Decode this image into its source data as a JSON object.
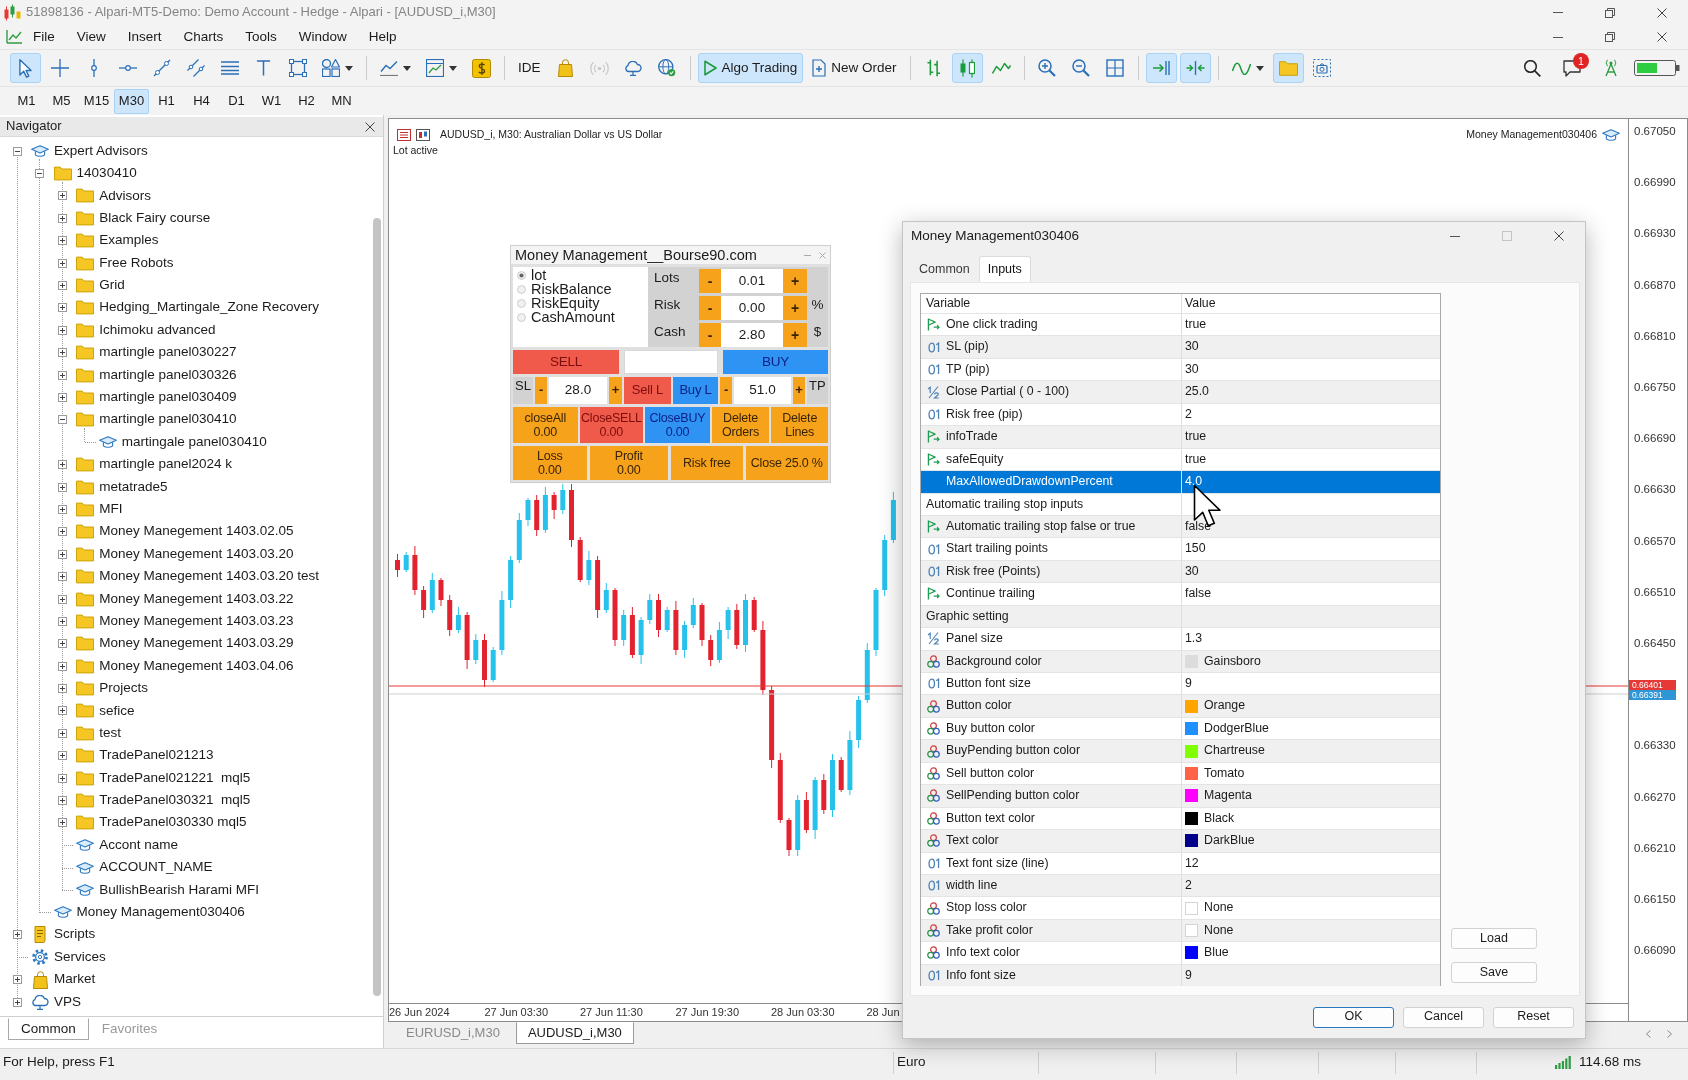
{
  "window": {
    "title": "51898136 - Alpari-MT5-Demo: Demo Account - Hedge - Alpari - [AUDUSD_i,M30]"
  },
  "menu": [
    "File",
    "View",
    "Insert",
    "Charts",
    "Tools",
    "Window",
    "Help"
  ],
  "toolbar": {
    "groups": [
      {
        "items": [
          {
            "selected": true
          },
          {
            "selected": false
          },
          {
            "selected": false
          },
          {
            "selected": false
          },
          {
            "selected": false
          },
          {
            "selected": false
          },
          {
            "selected": false
          },
          {
            "selected": false
          },
          {
            "selected": false
          },
          {
            "selected": false,
            "dropdown": true
          }
        ]
      },
      {
        "items": [
          {
            "selected": false,
            "dropdown": true
          },
          {
            "selected": false,
            "dropdown": true
          },
          {
            "selected": false
          }
        ]
      },
      {
        "items": [
          {
            "label": "IDE",
            "selected": false,
            "disabled": false
          },
          {
            "selected": false,
            "disabled": false
          },
          {
            "selected": false,
            "disabled": true
          },
          {
            "selected": false,
            "disabled": false
          },
          {
            "selected": false,
            "disabled": false
          }
        ]
      },
      {
        "items": [
          {
            "label": "Algo Trading",
            "selected": true
          },
          {
            "label": "New Order",
            "selected": false
          }
        ]
      },
      {
        "items": [
          {
            "selected": false
          },
          {
            "selected": true
          },
          {
            "selected": false
          }
        ]
      },
      {
        "items": [
          {
            "selected": false
          },
          {
            "selected": false
          },
          {
            "selected": false
          }
        ]
      },
      {
        "items": [
          {
            "selected": true
          },
          {
            "selected": true
          }
        ]
      },
      {
        "items": [
          {
            "selected": false,
            "dropdown": true
          },
          {
            "selected": true
          },
          {
            "selected": false
          }
        ]
      }
    ],
    "notification_badge": "1"
  },
  "timeframes": [
    {
      "label": "M1",
      "selected": false
    },
    {
      "label": "M5",
      "selected": false
    },
    {
      "label": "M15",
      "selected": false
    },
    {
      "label": "M30",
      "selected": true
    },
    {
      "label": "H1",
      "selected": false
    },
    {
      "label": "H4",
      "selected": false
    },
    {
      "label": "D1",
      "selected": false
    },
    {
      "label": "W1",
      "selected": false
    },
    {
      "label": "H2",
      "selected": false
    },
    {
      "label": "MN",
      "selected": false
    }
  ],
  "navigator": {
    "title": "Navigator",
    "items": [
      {
        "kind": "program",
        "label": "Expert Advisors",
        "expanded": true,
        "children": [
          {
            "kind": "folder",
            "label": "14030410",
            "expanded": true,
            "children": [
              {
                "kind": "folder",
                "label": "Advisors",
                "expanded": false
              },
              {
                "kind": "folder",
                "label": "Black Fairy course",
                "expanded": false
              },
              {
                "kind": "folder",
                "label": "Examples",
                "expanded": false
              },
              {
                "kind": "folder",
                "label": "Free Robots",
                "expanded": false
              },
              {
                "kind": "folder",
                "label": "Grid",
                "expanded": false
              },
              {
                "kind": "folder",
                "label": "Hedging_Martingale_Zone Recovery",
                "expanded": false
              },
              {
                "kind": "folder",
                "label": "Ichimoku advanced",
                "expanded": false
              },
              {
                "kind": "folder",
                "label": "martingle panel030227",
                "expanded": false
              },
              {
                "kind": "folder",
                "label": "martingle panel030326",
                "expanded": false
              },
              {
                "kind": "folder",
                "label": "martingle panel030409",
                "expanded": false
              },
              {
                "kind": "folder",
                "label": "martingle panel030410",
                "expanded": true,
                "children": [
                  {
                    "kind": "program",
                    "label": "martingale panel030410"
                  }
                ]
              },
              {
                "kind": "folder",
                "label": "martingle panel2024 k",
                "expanded": false
              },
              {
                "kind": "folder",
                "label": "metatrade5",
                "expanded": false
              },
              {
                "kind": "folder",
                "label": "MFI",
                "expanded": false
              },
              {
                "kind": "folder",
                "label": "Money Manegement 1403.02.05",
                "expanded": false
              },
              {
                "kind": "folder",
                "label": "Money Manegement 1403.03.20",
                "expanded": false
              },
              {
                "kind": "folder",
                "label": "Money Manegement 1403.03.20 test",
                "expanded": false
              },
              {
                "kind": "folder",
                "label": "Money Manegement 1403.03.22",
                "expanded": false
              },
              {
                "kind": "folder",
                "label": "Money Manegement 1403.03.23",
                "expanded": false
              },
              {
                "kind": "folder",
                "label": "Money Manegement 1403.03.29",
                "expanded": false
              },
              {
                "kind": "folder",
                "label": "Money Manegement 1403.04.06",
                "expanded": false
              },
              {
                "kind": "folder",
                "label": "Projects",
                "expanded": false
              },
              {
                "kind": "folder",
                "label": "sefice",
                "expanded": false
              },
              {
                "kind": "folder",
                "label": "test",
                "expanded": false
              },
              {
                "kind": "folder",
                "label": "TradePanel021213",
                "expanded": false
              },
              {
                "kind": "folder",
                "label": "TradePanel021221  mql5",
                "expanded": false
              },
              {
                "kind": "folder",
                "label": "TradePanel030321  mql5",
                "expanded": false
              },
              {
                "kind": "folder",
                "label": "TradePanel030330 mql5",
                "expanded": false
              },
              {
                "kind": "program",
                "label": "Accont name"
              },
              {
                "kind": "program",
                "label": "ACCOUNT_NAME"
              },
              {
                "kind": "program",
                "label": "BullishBearish Harami MFI"
              }
            ]
          },
          {
            "kind": "program",
            "label": "Money Management030406"
          }
        ]
      },
      {
        "kind": "scripts",
        "label": "Scripts",
        "expanded": false
      },
      {
        "kind": "services",
        "label": "Services"
      },
      {
        "kind": "market",
        "label": "Market",
        "expanded": false
      },
      {
        "kind": "vps",
        "label": "VPS",
        "expanded": false
      }
    ],
    "tabs": [
      {
        "label": "Common",
        "selected": true
      },
      {
        "label": "Favorites",
        "selected": false
      }
    ]
  },
  "chart": {
    "caption": "AUDUSD_i, M30: Australian Dollar vs US Dollar",
    "status_text": "Lot active",
    "expert": "Money Management030406",
    "price_axis": [
      {
        "kind": "label",
        "text": "0.67050"
      },
      {
        "kind": "label",
        "text": "0.66990"
      },
      {
        "kind": "label",
        "text": "0.66930"
      },
      {
        "kind": "label",
        "text": "0.66870"
      },
      {
        "kind": "label",
        "text": "0.66810"
      },
      {
        "kind": "label",
        "text": "0.66750"
      },
      {
        "kind": "label",
        "text": "0.66690"
      },
      {
        "kind": "label",
        "text": "0.66630"
      },
      {
        "kind": "label",
        "text": "0.66570"
      },
      {
        "kind": "label",
        "text": "0.66510"
      },
      {
        "kind": "label",
        "text": "0.66450"
      },
      {
        "kind": "bid",
        "text": "0.66401"
      },
      {
        "kind": "ask",
        "text": "0.66391"
      },
      {
        "kind": "label",
        "text": "0.66330"
      },
      {
        "kind": "label",
        "text": "0.66270"
      },
      {
        "kind": "label",
        "text": "0.66210"
      },
      {
        "kind": "label",
        "text": "0.66150"
      },
      {
        "kind": "label",
        "text": "0.66090"
      }
    ],
    "time_labels": [
      "26 Jun 2024",
      "27 Jun 03:30",
      "27 Jun 11:30",
      "27 Jun 19:30",
      "28 Jun 03:30",
      "28 Jun"
    ],
    "tabs": [
      {
        "label": "EURUSD_i,M30",
        "selected": false
      },
      {
        "label": "AUDUSD_i,M30",
        "selected": true
      }
    ]
  },
  "trade_panel": {
    "title": "Money Management__Bourse90.com",
    "modes": [
      {
        "label": "lot",
        "selected": true
      },
      {
        "label": "RiskBalance",
        "selected": false
      },
      {
        "label": "RiskEquity",
        "selected": false
      },
      {
        "label": "CashAmount",
        "selected": false
      }
    ],
    "amounts": [
      {
        "label": "Lots",
        "minus": "-",
        "value": "0.01",
        "plus": "+"
      },
      {
        "label": "Risk",
        "minus": "-",
        "value": "0.00",
        "plus": "+",
        "unit": "%"
      },
      {
        "label": "Cash",
        "minus": "-",
        "value": "2.80",
        "plus": "+",
        "unit": "$"
      }
    ],
    "order_row": [
      {
        "kind": "sell",
        "label": "SELL"
      },
      {
        "kind": "field"
      },
      {
        "kind": "buy",
        "label": "BUY"
      }
    ],
    "stop_row": [
      {
        "kind": "caption",
        "label": "SL"
      },
      {
        "kind": "minus",
        "label": "-"
      },
      {
        "kind": "field",
        "value": "28.0"
      },
      {
        "kind": "plus",
        "label": "+"
      },
      {
        "kind": "sell",
        "label": "Sell L"
      },
      {
        "kind": "buy",
        "label": "Buy L"
      },
      {
        "kind": "minus",
        "label": "-"
      },
      {
        "kind": "field",
        "value": "51.0"
      },
      {
        "kind": "plus",
        "label": "+"
      },
      {
        "kind": "caption",
        "label": "TP"
      }
    ],
    "actions": [
      [
        {
          "kind": "neutral",
          "lines": [
            "closeAll",
            "0.00"
          ]
        },
        {
          "kind": "sell",
          "lines": [
            "CloseSELL",
            "0.00"
          ]
        },
        {
          "kind": "buy",
          "lines": [
            "CloseBUY",
            "0.00"
          ]
        },
        {
          "kind": "neutral",
          "lines": [
            "Delete",
            "Orders"
          ]
        },
        {
          "kind": "neutral",
          "lines": [
            "Delete",
            "Lines"
          ]
        }
      ],
      [
        {
          "kind": "neutral",
          "lines": [
            "Loss",
            "0.00"
          ]
        },
        {
          "kind": "neutral",
          "lines": [
            "Profit",
            "0.00"
          ]
        },
        {
          "kind": "neutral",
          "lines": [
            "Risk free"
          ]
        },
        {
          "kind": "neutral",
          "lines": [
            "Close 25.0 %"
          ]
        }
      ]
    ]
  },
  "dialog": {
    "title": "Money Management030406",
    "tabs": [
      {
        "label": "Common",
        "selected": false
      },
      {
        "label": "Inputs",
        "selected": true
      }
    ],
    "columns": [
      "Variable",
      "Value"
    ],
    "rows": [
      {
        "kind": "bool",
        "variable": "One click trading",
        "value": "true",
        "selected": false
      },
      {
        "kind": "int",
        "variable": "SL (pip)",
        "value": "30",
        "selected": false
      },
      {
        "kind": "int",
        "variable": "TP (pip)",
        "value": "30",
        "selected": false
      },
      {
        "kind": "double",
        "variable": "Close Partial ( 0 - 100)",
        "value": "25.0",
        "selected": false
      },
      {
        "kind": "int",
        "variable": "Risk free (pip)",
        "value": "2",
        "selected": false
      },
      {
        "kind": "bool",
        "variable": "infoTrade",
        "value": "true",
        "selected": false
      },
      {
        "kind": "bool",
        "variable": "safeEquity",
        "value": "true",
        "selected": false
      },
      {
        "kind": "plain",
        "variable": "MaxAllowedDrawdownPercent",
        "value": "4.0",
        "selected": true
      },
      {
        "kind": "group",
        "variable": "Automatic trailing stop inputs",
        "selected": false
      },
      {
        "kind": "bool",
        "variable": "Automatic trailing stop false or true",
        "value": "false",
        "selected": false
      },
      {
        "kind": "int",
        "variable": "Start trailing points",
        "value": "150",
        "selected": false
      },
      {
        "kind": "int",
        "variable": "Risk free (Points)",
        "value": "30",
        "selected": false
      },
      {
        "kind": "bool",
        "variable": "Continue trailing",
        "value": "false",
        "selected": false
      },
      {
        "kind": "group",
        "variable": "Graphic setting",
        "selected": false
      },
      {
        "kind": "double",
        "variable": "Panel size",
        "value": "1.3",
        "selected": false
      },
      {
        "kind": "color",
        "variable": "Background color",
        "value": "Gainsboro",
        "color": "#dcdcdc",
        "selected": false
      },
      {
        "kind": "int",
        "variable": "Button font size",
        "value": "9",
        "selected": false
      },
      {
        "kind": "color",
        "variable": "Button color",
        "value": "Orange",
        "color": "#ffa500",
        "selected": false
      },
      {
        "kind": "color",
        "variable": "Buy button color",
        "value": "DodgerBlue",
        "color": "#1e90ff",
        "selected": false
      },
      {
        "kind": "color",
        "variable": "BuyPending button color",
        "value": "Chartreuse",
        "color": "#7fff00",
        "selected": false
      },
      {
        "kind": "color",
        "variable": "Sell button color",
        "value": "Tomato",
        "color": "#ff6347",
        "selected": false
      },
      {
        "kind": "color",
        "variable": "SellPending button color",
        "value": "Magenta",
        "color": "#ff00ff",
        "selected": false
      },
      {
        "kind": "color",
        "variable": "Button text color",
        "value": "Black",
        "color": "#000000",
        "selected": false
      },
      {
        "kind": "color",
        "variable": "Text color",
        "value": "DarkBlue",
        "color": "#00008b",
        "selected": false
      },
      {
        "kind": "int",
        "variable": "Text font size (line)",
        "value": "12",
        "selected": false
      },
      {
        "kind": "int",
        "variable": "width line",
        "value": "2",
        "selected": false
      },
      {
        "kind": "color",
        "variable": "Stop loss color",
        "value": "None",
        "selected": false
      },
      {
        "kind": "color",
        "variable": "Take profit color",
        "value": "None",
        "selected": false
      },
      {
        "kind": "color",
        "variable": "Info text color",
        "value": "Blue",
        "color": "#0000ff",
        "selected": false
      },
      {
        "kind": "int",
        "variable": "Info font size",
        "value": "9",
        "selected": false
      }
    ],
    "side_buttons": [
      "Load",
      "Save"
    ],
    "buttons": [
      {
        "label": "OK",
        "default": true
      },
      {
        "label": "Cancel",
        "default": false
      },
      {
        "label": "Reset",
        "default": false
      }
    ]
  },
  "status_bar": {
    "help": "For Help, press F1",
    "profile": "Euro",
    "ping": "114.68 ms"
  }
}
